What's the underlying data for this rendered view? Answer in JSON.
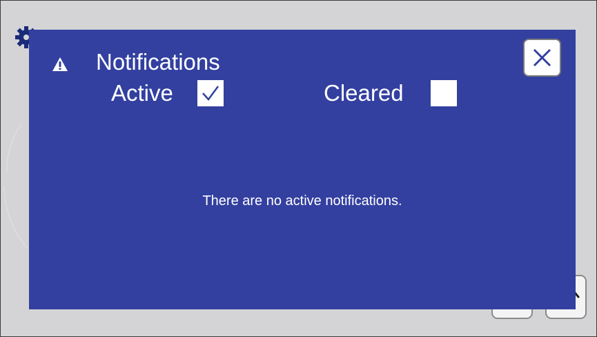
{
  "dialog": {
    "title": "Notifications",
    "title_icon": "warning-triangle-icon",
    "background_color": "#3340a0",
    "close_icon": "close-x-icon",
    "filters": {
      "active": {
        "label": "Active",
        "checked": true
      },
      "cleared": {
        "label": "Cleared",
        "checked": false
      }
    },
    "empty_message": "There are no active notifications."
  },
  "background": {
    "color": "#d4d4d6",
    "settings_icon": "gear-icon"
  }
}
